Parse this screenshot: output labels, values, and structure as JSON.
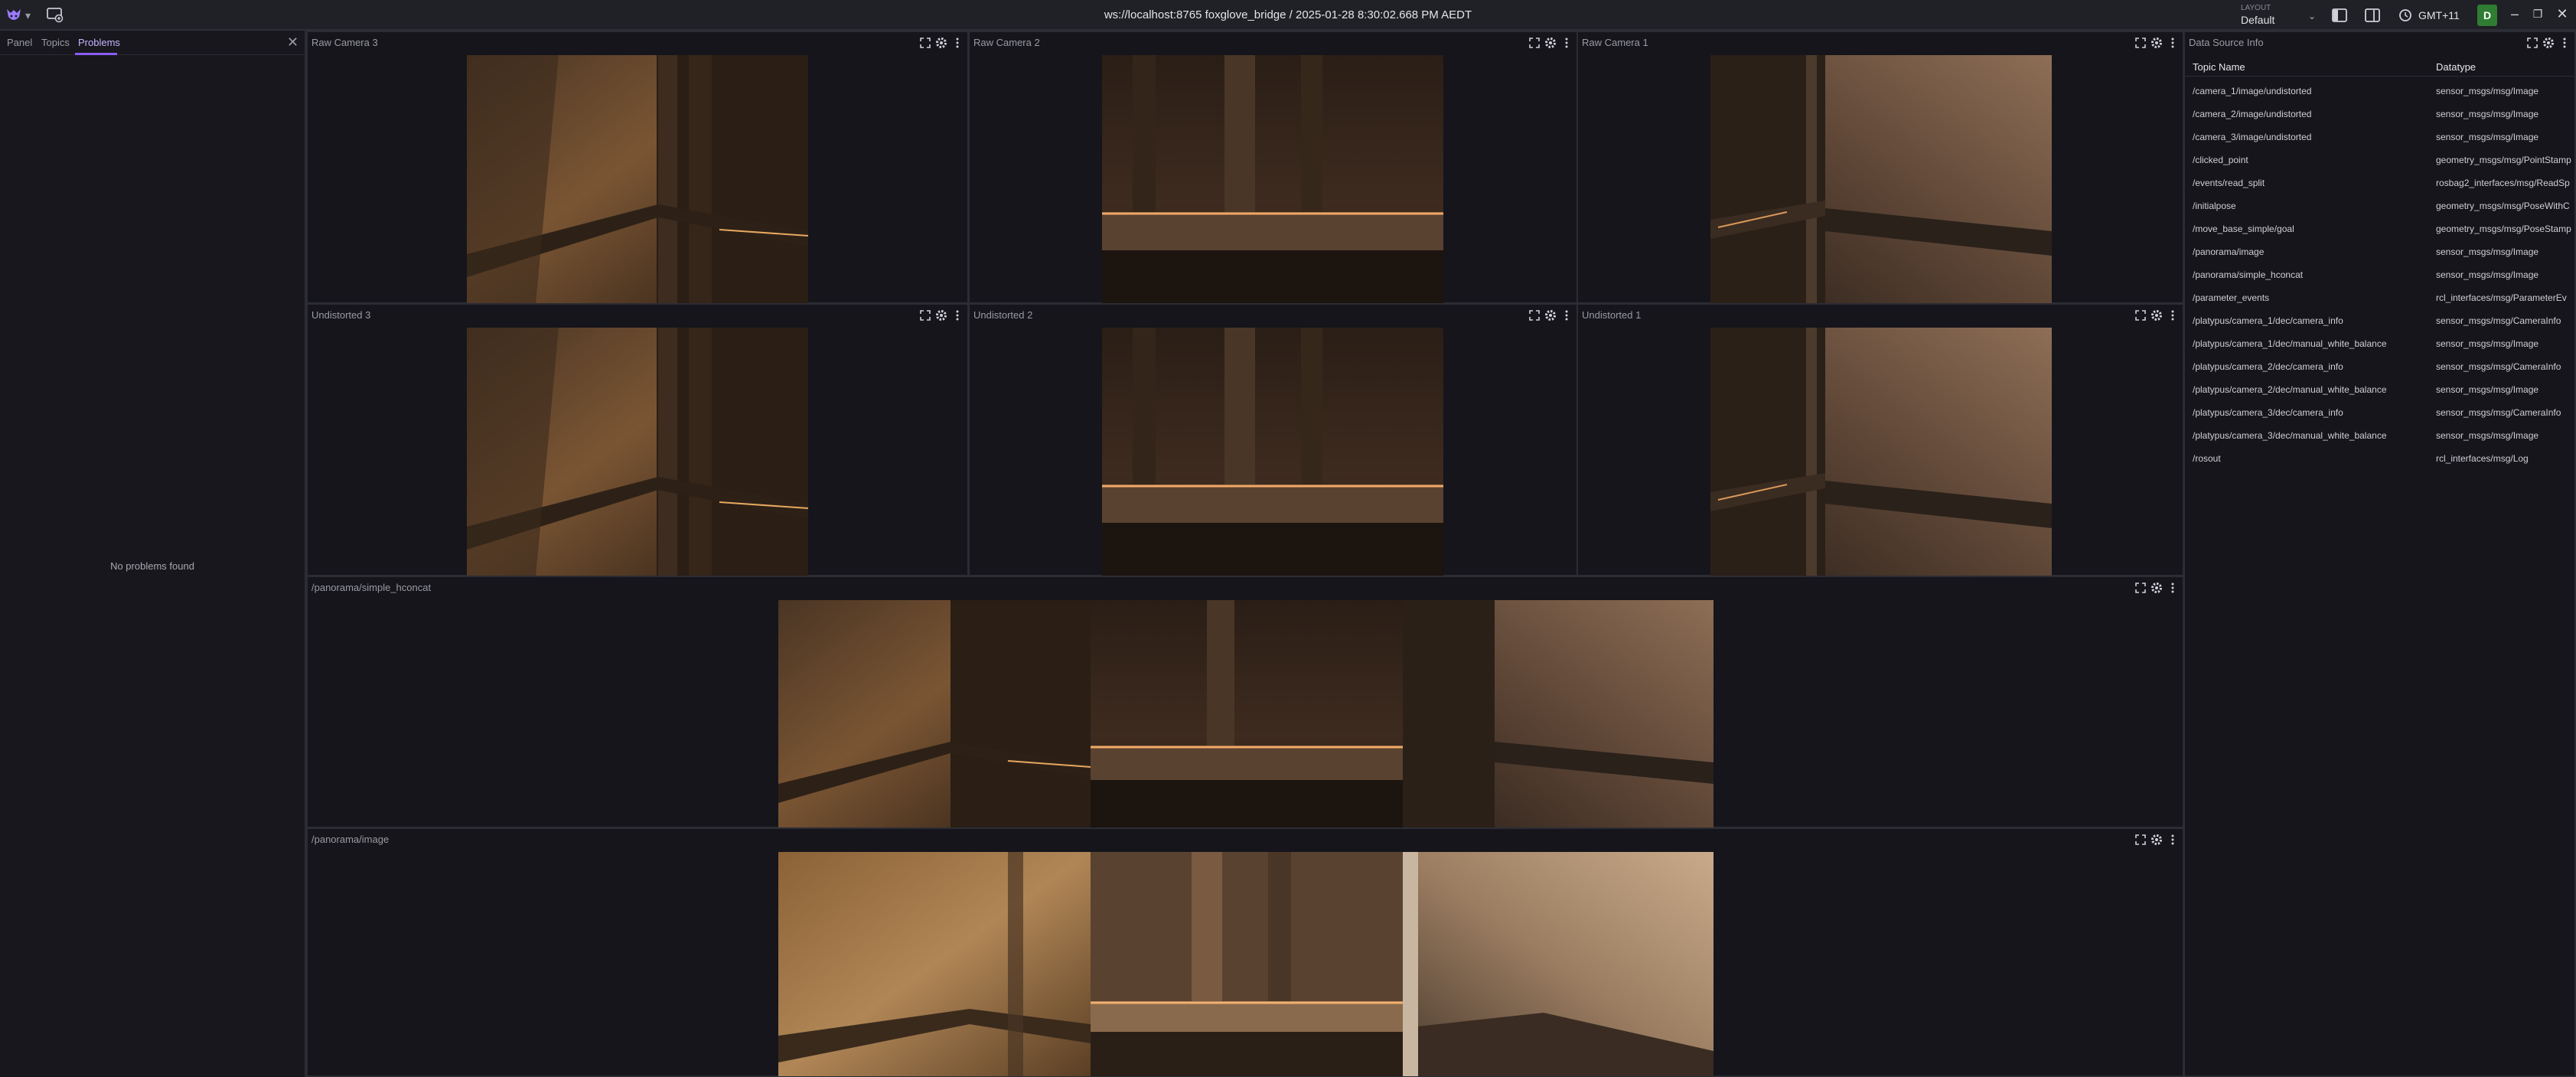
{
  "app": {
    "title": "ws://localhost:8765 foxglove_bridge / 2025-01-28 8:30:02.668 PM AEDT",
    "layout_label": "LAYOUT",
    "layout_value": "Default",
    "timezone": "GMT+11",
    "user_initial": "D"
  },
  "sidebar": {
    "tabs": [
      {
        "label": "Panel"
      },
      {
        "label": "Topics"
      },
      {
        "label": "Problems"
      }
    ],
    "active_tab": "Problems",
    "empty_message": "No problems found"
  },
  "panels": {
    "raw3": {
      "title": "Raw Camera 3"
    },
    "raw2": {
      "title": "Raw Camera 2"
    },
    "raw1": {
      "title": "Raw Camera 1"
    },
    "und3": {
      "title": "Undistorted 3"
    },
    "und2": {
      "title": "Undistorted 2"
    },
    "und1": {
      "title": "Undistorted 1"
    },
    "hconcat": {
      "title": "/panorama/simple_hconcat"
    },
    "pano": {
      "title": "/panorama/image"
    }
  },
  "data_source_info": {
    "title": "Data Source Info",
    "columns": [
      "Topic Name",
      "Datatype"
    ],
    "rows": [
      {
        "topic": "/camera_1/image/undistorted",
        "datatype": "sensor_msgs/msg/Image"
      },
      {
        "topic": "/camera_2/image/undistorted",
        "datatype": "sensor_msgs/msg/Image"
      },
      {
        "topic": "/camera_3/image/undistorted",
        "datatype": "sensor_msgs/msg/Image"
      },
      {
        "topic": "/clicked_point",
        "datatype": "geometry_msgs/msg/PointStamp"
      },
      {
        "topic": "/events/read_split",
        "datatype": "rosbag2_interfaces/msg/ReadSp"
      },
      {
        "topic": "/initialpose",
        "datatype": "geometry_msgs/msg/PoseWithC"
      },
      {
        "topic": "/move_base_simple/goal",
        "datatype": "geometry_msgs/msg/PoseStamp"
      },
      {
        "topic": "/panorama/image",
        "datatype": "sensor_msgs/msg/Image"
      },
      {
        "topic": "/panorama/simple_hconcat",
        "datatype": "sensor_msgs/msg/Image"
      },
      {
        "topic": "/parameter_events",
        "datatype": "rcl_interfaces/msg/ParameterEv"
      },
      {
        "topic": "/platypus/camera_1/dec/camera_info",
        "datatype": "sensor_msgs/msg/CameraInfo"
      },
      {
        "topic": "/platypus/camera_1/dec/manual_white_balance",
        "datatype": "sensor_msgs/msg/Image"
      },
      {
        "topic": "/platypus/camera_2/dec/camera_info",
        "datatype": "sensor_msgs/msg/CameraInfo"
      },
      {
        "topic": "/platypus/camera_2/dec/manual_white_balance",
        "datatype": "sensor_msgs/msg/Image"
      },
      {
        "topic": "/platypus/camera_3/dec/camera_info",
        "datatype": "sensor_msgs/msg/CameraInfo"
      },
      {
        "topic": "/platypus/camera_3/dec/manual_white_balance",
        "datatype": "sensor_msgs/msg/Image"
      },
      {
        "topic": "/rosout",
        "datatype": "rcl_interfaces/msg/Log"
      }
    ]
  },
  "colors": {
    "accent": "#8b5cf6",
    "avatar": "#2f7d32",
    "background": "#15151b"
  }
}
